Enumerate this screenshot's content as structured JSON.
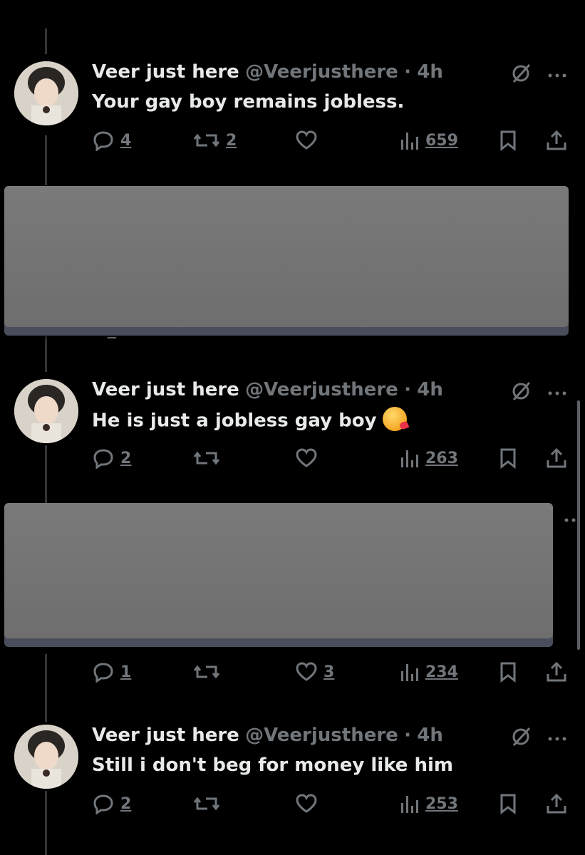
{
  "tweets": [
    {
      "name": "Veer just here",
      "handle": "@Veerjusthere",
      "dot": "·",
      "time": "4h",
      "text": "Your gay boy remains jobless.",
      "replies": "4",
      "retweets": "2",
      "likes": "",
      "views": "659"
    },
    {
      "name": "Veer just here",
      "handle": "@Veerjusthere",
      "dot": "·",
      "time": "4h",
      "text": "He is just a jobless gay boy",
      "emoji": "kissing-face-emoji",
      "replies": "2",
      "retweets": "",
      "likes": "",
      "views": "263"
    },
    {
      "name": "Veer just here",
      "handle": "@Veerjusthere",
      "dot": "·",
      "time": "4h",
      "text": "Still i don't beg for money like him",
      "replies": "2",
      "retweets": "",
      "likes": "",
      "views": "253"
    }
  ],
  "redacted_tweet": {
    "replies": "1",
    "retweets": "",
    "likes": "3",
    "views": "234"
  },
  "icons": {
    "reply": "reply-icon",
    "retweet": "retweet-icon",
    "like": "heart-icon",
    "views": "views-icon",
    "bookmark": "bookmark-icon",
    "share": "share-icon",
    "grok": "grok-icon",
    "more": "more-icon"
  },
  "colors": {
    "background": "#000000",
    "text": "#e7e9ea",
    "muted": "#71767b",
    "redaction": "#707070"
  }
}
